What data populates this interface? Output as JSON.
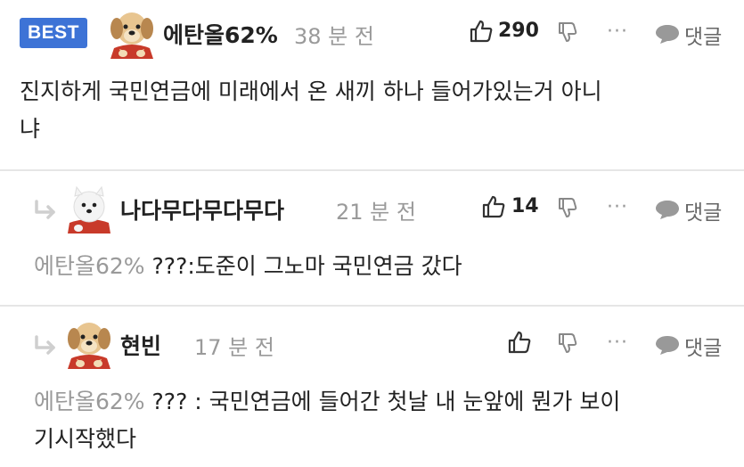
{
  "comments": [
    {
      "badge": "BEST",
      "author": "에탄올62%",
      "time": "38 분 전",
      "likes": "290",
      "reply_label": "댓글",
      "more": "···",
      "text_line1": "진지하게 국민연금에 미래에서 온 새끼 하나 들어가있는거 아니",
      "text_line2": "냐"
    },
    {
      "author": "나다무다무다무다",
      "time": "21 분 전",
      "likes": "14",
      "reply_label": "댓글",
      "more": "···",
      "mention": "에탄올62%",
      "text": " ???:도준이 그노마 국민연금 갔다"
    },
    {
      "author": "현빈",
      "time": "17 분 전",
      "likes": "",
      "reply_label": "댓글",
      "more": "···",
      "mention": "에탄올62%",
      "text_line1": " ??? : 국민연금에 들어간 첫날 내 눈앞에 뭔가 보이",
      "text_line2": "기시작했다"
    }
  ],
  "colors": {
    "badge": "#3d73d6",
    "muted": "#9a9a9a",
    "divider": "#e6e6e6"
  },
  "icons": [
    "puppy-avatar",
    "dog-avatar",
    "thumbs-up-icon",
    "thumbs-down-icon",
    "more-icon",
    "speech-bubble-icon",
    "reply-arrow-icon"
  ]
}
